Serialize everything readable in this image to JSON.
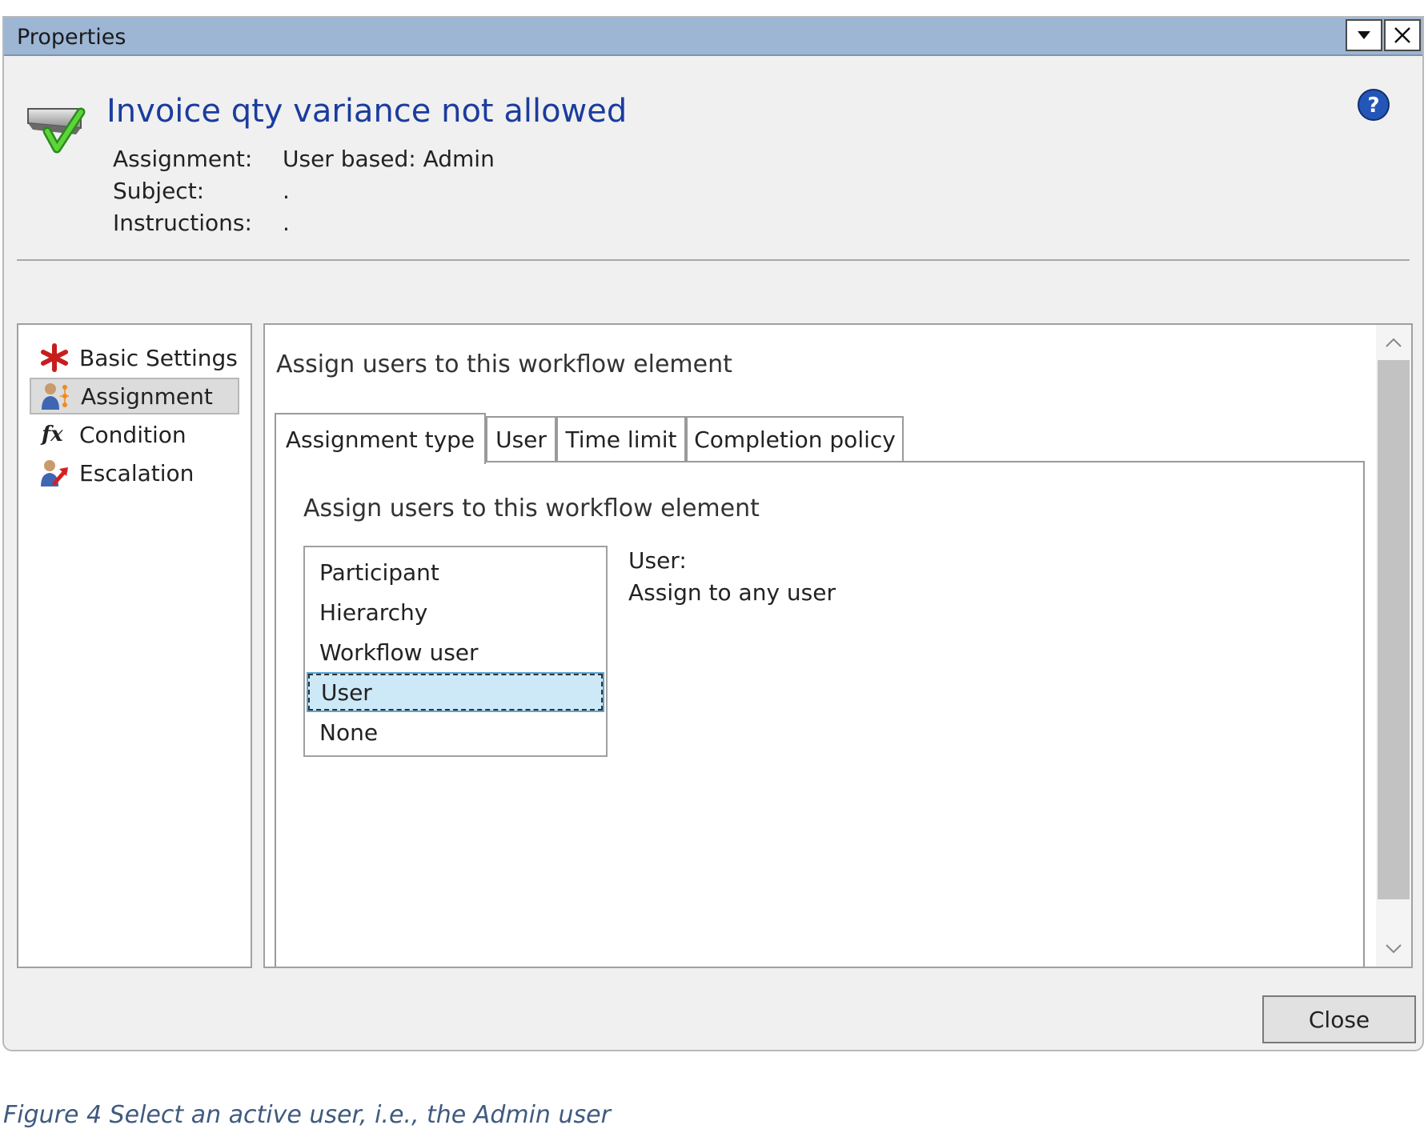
{
  "window": {
    "title": "Properties",
    "heading": "Invoice qty variance not allowed",
    "info": [
      {
        "label": "Assignment:",
        "value": "User based: Admin"
      },
      {
        "label": "Subject:",
        "value": "."
      },
      {
        "label": "Instructions:",
        "value": "."
      }
    ]
  },
  "nav": {
    "items": [
      {
        "label": "Basic Settings",
        "icon": "red-asterisk-icon",
        "selected": false
      },
      {
        "label": "Assignment",
        "icon": "assignment-users-icon",
        "selected": true
      },
      {
        "label": "Condition",
        "icon": "function-fx-icon",
        "selected": false
      },
      {
        "label": "Escalation",
        "icon": "escalation-user-icon",
        "selected": false
      }
    ]
  },
  "content": {
    "title": "Assign users to this workflow element",
    "tabs": [
      {
        "label": "Assignment type",
        "active": true
      },
      {
        "label": "User",
        "active": false
      },
      {
        "label": "Time limit",
        "active": false
      },
      {
        "label": "Completion policy",
        "active": false
      }
    ],
    "panel": {
      "title": "Assign users to this workflow element",
      "options": [
        "Participant",
        "Hierarchy",
        "Workflow user",
        "User",
        "None"
      ],
      "selected_option": "User",
      "detail_heading": "User:",
      "detail_text": "Assign to any user"
    }
  },
  "footer": {
    "close_label": "Close"
  },
  "caption": "Figure 4 Select an active user, i.e., the Admin user",
  "colors": {
    "titlebar": "#9cb6d4",
    "heading": "#1b3c9e",
    "selection": "#cde8f6",
    "caption": "#3f5a7f"
  }
}
